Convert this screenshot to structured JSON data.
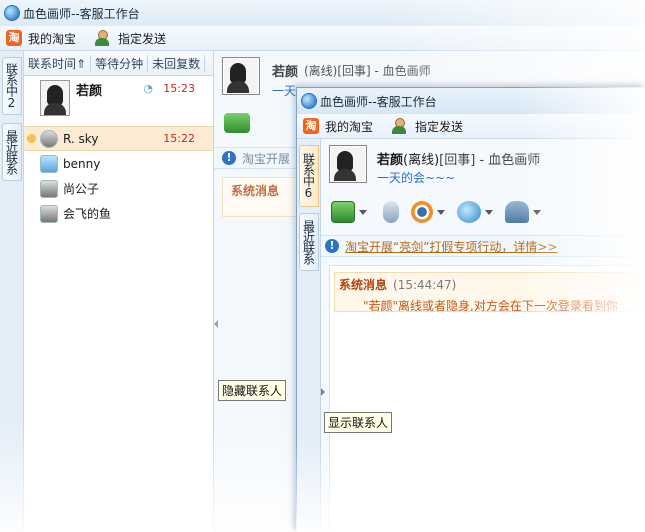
{
  "back_window": {
    "title": "血色画师--客服工作台",
    "menu": {
      "my_taobao": "我的淘宝",
      "assign_send": "指定发送"
    },
    "tabs": {
      "contacts": "联系中2",
      "recent": "最近联系"
    },
    "columns": [
      "联系时间⇑",
      "等待分钟",
      "未回复数"
    ],
    "contacts": [
      {
        "name": "若颜",
        "time": "15:23"
      },
      {
        "name": "R. sky",
        "time": "15:22"
      },
      {
        "name": "benny",
        "time": ""
      },
      {
        "name": "尚公子",
        "time": ""
      },
      {
        "name": "会飞的鱼",
        "time": ""
      }
    ],
    "profile_name": "若颜",
    "status_text": "(离线)[回事] - 血色画师",
    "signature": "一天",
    "notice_partial": "淘宝开展",
    "sys_partial": "系统消息",
    "hide_tip": "隐藏联系人"
  },
  "front_window": {
    "title": "血色画师--客服工作台",
    "menu": {
      "my_taobao": "我的淘宝",
      "assign_send": "指定发送"
    },
    "tabs": {
      "contacts": "联系中6",
      "recent": "最近联系"
    },
    "profile": {
      "name": "若颜",
      "status": "(离线)",
      "tag": "[回事]",
      "suffix": " - 血色画师",
      "signature": "一天的会~~~"
    },
    "notice": "淘宝开展“亮剑”打假专项行动，详情>>",
    "system_message": {
      "label": "系统消息",
      "time": "(15:44:47)",
      "body": "\"若颜\"离线或者隐身,对方会在下一次登录看到你"
    },
    "show_tip": "显示联系人"
  }
}
